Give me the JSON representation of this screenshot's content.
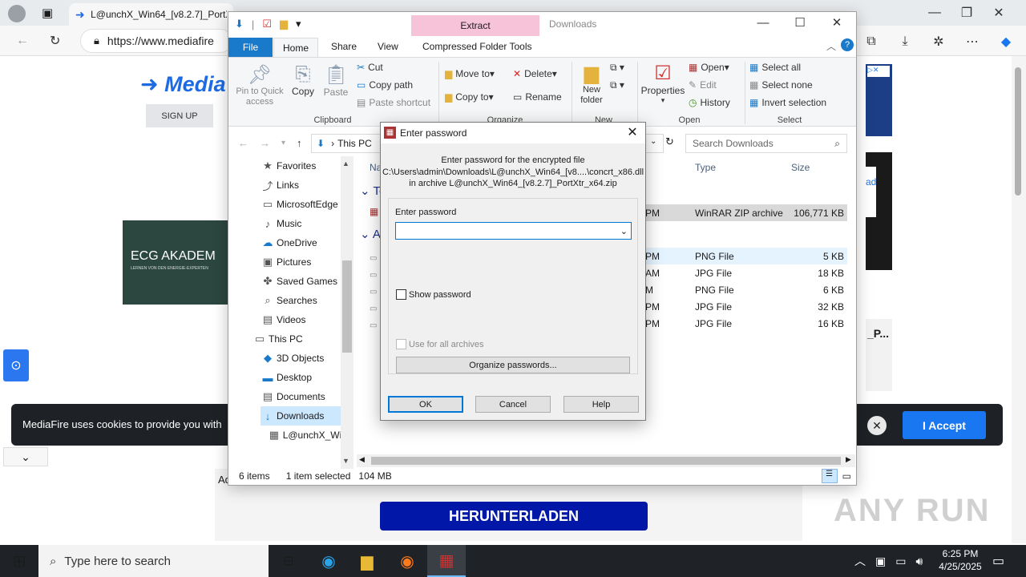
{
  "browser": {
    "tab_title": "L@unchX_Win64_[v8.2.7]_PortXt",
    "url": "https://www.mediafire",
    "colors": {
      "accent": "#1d6ae5"
    }
  },
  "page": {
    "logo": "Media",
    "signup": "SIGN UP",
    "ad_left_text": "ECG AKADEM",
    "ad_left_sub": "LERNEN VON DEN ENERGIE-EXPERTEN",
    "ad_card_text": "ad",
    "ad_card2_text": "_P...",
    "cookie_text": "MediaFire uses cookies to provide you with",
    "accept": "I Accept",
    "download": "HERUNTERLADEN",
    "bottom_label": "Ad",
    "watermark": "ANY RUN"
  },
  "explorer": {
    "extract_tab": "Extract",
    "title": "Downloads",
    "tabs": [
      "File",
      "Home",
      "Share",
      "View",
      "Compressed Folder Tools"
    ],
    "clipboard": {
      "pin": "Pin to Quick access",
      "copy": "Copy",
      "paste": "Paste",
      "cut": "Cut",
      "copy_path": "Copy path",
      "paste_shortcut": "Paste shortcut",
      "group": "Clipboard"
    },
    "organize": {
      "move_to": "Move to",
      "copy_to": "Copy to",
      "delete": "Delete",
      "rename": "Rename",
      "group": "Organize"
    },
    "new": {
      "new_folder": "New folder",
      "group": "New"
    },
    "open": {
      "properties": "Properties",
      "open": "Open",
      "edit": "Edit",
      "history": "History",
      "group": "Open"
    },
    "select": {
      "select_all": "Select all",
      "select_none": "Select none",
      "invert": "Invert selection",
      "group": "Select"
    },
    "address": "This PC",
    "search_placeholder": "Search Downloads",
    "nav_items": [
      {
        "label": "Favorites",
        "icon": "★"
      },
      {
        "label": "Links",
        "icon": "⤴"
      },
      {
        "label": "MicrosoftEdge",
        "icon": "▭"
      },
      {
        "label": "Music",
        "icon": "♪"
      },
      {
        "label": "OneDrive",
        "icon": "☁"
      },
      {
        "label": "Pictures",
        "icon": "▣"
      },
      {
        "label": "Saved Games",
        "icon": "✤"
      },
      {
        "label": "Searches",
        "icon": "⌕"
      },
      {
        "label": "Videos",
        "icon": "▤"
      },
      {
        "label": "This PC",
        "icon": "▭"
      },
      {
        "label": "3D Objects",
        "icon": "◆"
      },
      {
        "label": "Desktop",
        "icon": "▬"
      },
      {
        "label": "Documents",
        "icon": "▤"
      },
      {
        "label": "Downloads",
        "icon": "↓"
      },
      {
        "label": "L@unchX_Wi",
        "icon": "▦"
      }
    ],
    "columns": {
      "name": "Na",
      "type": "Type",
      "size": "Size"
    },
    "group_today": "To",
    "group_earlier": "A",
    "files": [
      {
        "time": "PM",
        "type": "WinRAR ZIP archive",
        "size": "106,771 KB",
        "selected": true
      },
      {
        "time": "PM",
        "type": "PNG File",
        "size": "5 KB"
      },
      {
        "time": "AM",
        "type": "JPG File",
        "size": "18 KB"
      },
      {
        "time": "M",
        "type": "PNG File",
        "size": "6 KB"
      },
      {
        "time": "PM",
        "type": "JPG File",
        "size": "32 KB"
      },
      {
        "time": "PM",
        "type": "JPG File",
        "size": "16 KB"
      }
    ],
    "status": {
      "items": "6 items",
      "selected": "1 item selected",
      "size": "104 MB"
    }
  },
  "dialog": {
    "title": "Enter password",
    "desc_line1": "Enter password for the encrypted file",
    "desc_line2": "C:\\Users\\admin\\Downloads\\L@unchX_Win64_[v8....\\concrt_x86.dll",
    "desc_line3": "in archive L@unchX_Win64_[v8.2.7]_PortXtr_x64.zip",
    "label": "Enter password",
    "password_value": "",
    "show_password": "Show password",
    "use_all": "Use for all archives",
    "organize": "Organize passwords...",
    "ok": "OK",
    "cancel": "Cancel",
    "help": "Help"
  },
  "taskbar": {
    "search": "Type here to search",
    "time": "6:25 PM",
    "date": "4/25/2025"
  }
}
